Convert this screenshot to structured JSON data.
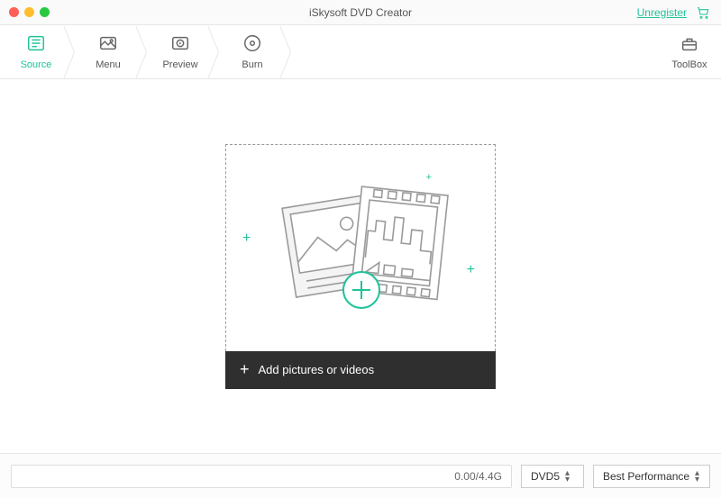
{
  "titlebar": {
    "title": "iSkysoft DVD Creator",
    "unregister": "Unregister"
  },
  "steps": {
    "source": "Source",
    "menu": "Menu",
    "preview": "Preview",
    "burn": "Burn",
    "toolbox": "ToolBox"
  },
  "dropzone": {
    "add_label": "Add pictures or videos"
  },
  "footer": {
    "capacity": "0.00/4.4G",
    "disc_type": "DVD5",
    "quality": "Best Performance"
  }
}
